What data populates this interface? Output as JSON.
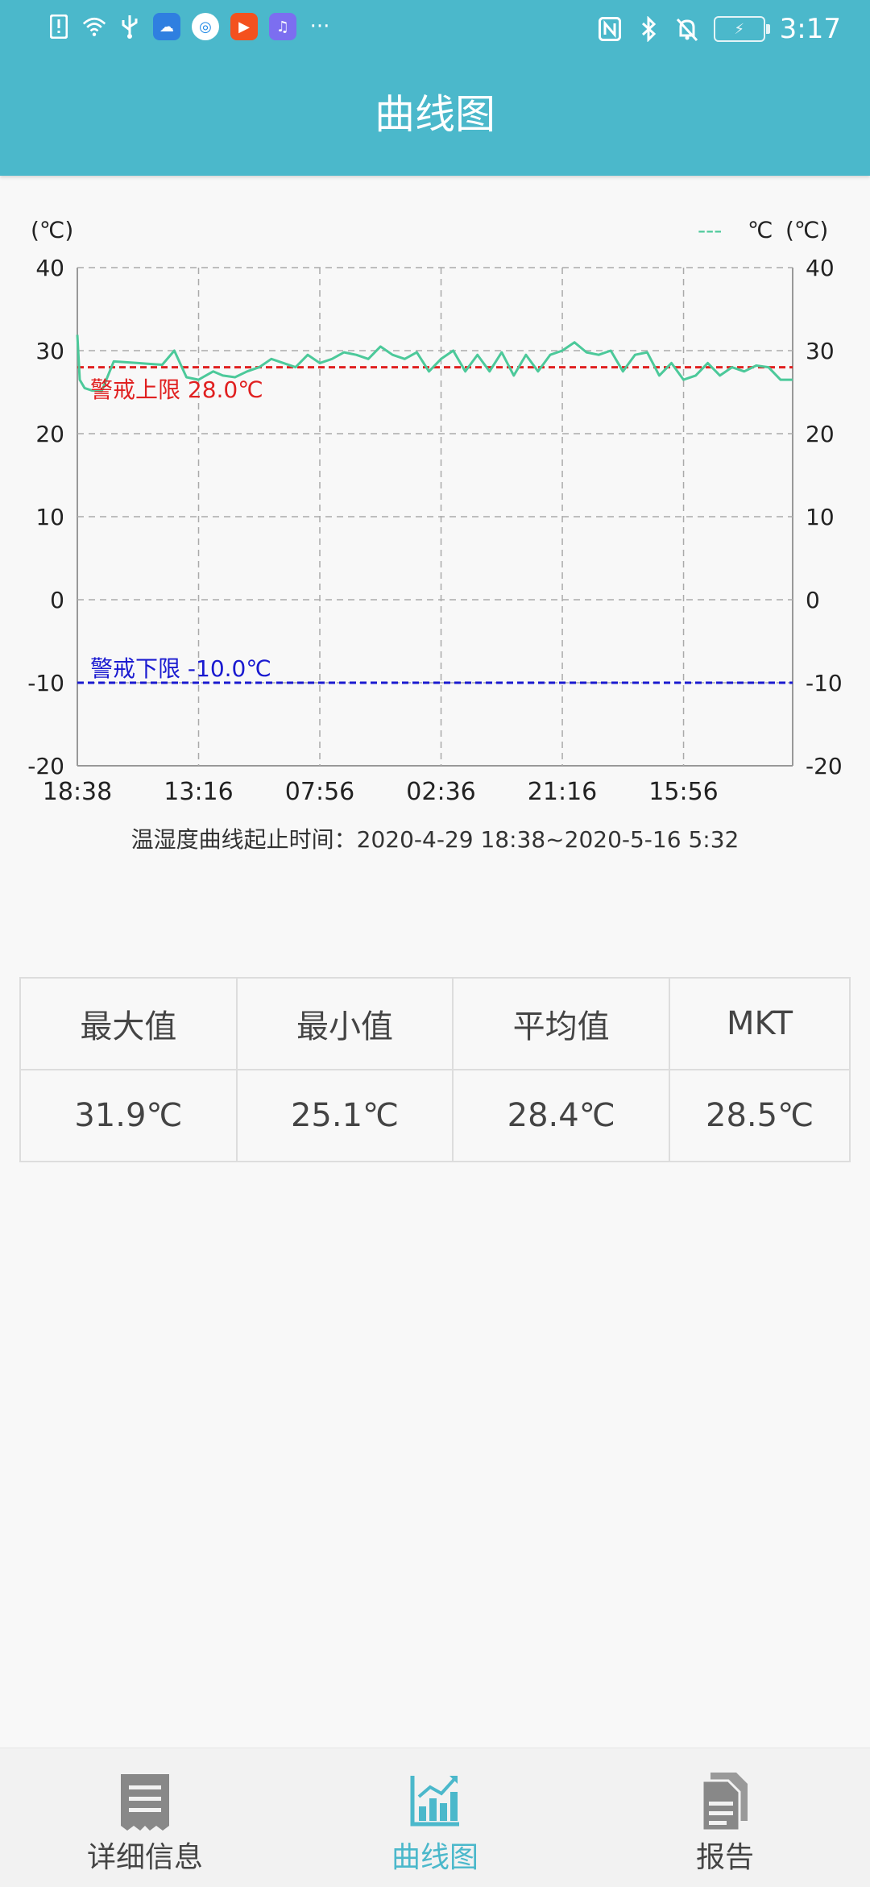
{
  "status_bar": {
    "time": "3:17",
    "left_icons": [
      "alert-icon",
      "wifi-icon",
      "usb-icon",
      "cloud-app-icon",
      "browser-app-icon",
      "video-app-icon",
      "music-app-icon",
      "more-dots-icon"
    ],
    "right_icons": [
      "nfc-icon",
      "bluetooth-icon",
      "mute-icon",
      "battery-charging-icon"
    ],
    "more": "···"
  },
  "header": {
    "title": "曲线图"
  },
  "chart": {
    "left_unit": "(℃)",
    "right_unit": "(℃)",
    "legend": {
      "marker": "---",
      "label": "℃"
    },
    "upper_limit_label": "警戒上限 28.0℃",
    "lower_limit_label": "警戒下限 -10.0℃",
    "upper_color": "#e02020",
    "lower_color": "#1a1ad0",
    "line_color": "#4cc99a"
  },
  "chart_data": {
    "type": "line",
    "ylim": [
      -20,
      40
    ],
    "y_ticks": [
      "40",
      "30",
      "20",
      "10",
      "0",
      "-10",
      "-20"
    ],
    "x_ticks": [
      "18:38",
      "13:16",
      "07:56",
      "02:36",
      "21:16",
      "15:56"
    ],
    "thresholds": [
      {
        "name": "警戒上限",
        "value": 28.0
      },
      {
        "name": "警戒下限",
        "value": -10.0
      }
    ],
    "series": [
      {
        "name": "℃",
        "x": [
          0,
          0.1,
          0.3,
          0.6,
          1.0,
          1.5,
          2.0,
          2.5,
          3.0,
          3.5,
          4.0,
          4.5,
          5.0,
          5.3,
          5.6,
          6.0,
          6.5,
          7.0,
          7.5,
          8.0,
          8.5,
          9.0,
          9.5,
          10.0,
          10.5,
          11.0,
          11.5,
          12.0,
          12.5,
          13.0,
          13.5,
          14.0,
          14.5,
          15.0,
          15.5,
          16.0,
          16.5,
          17.0,
          17.5,
          18.0,
          18.5,
          19.0,
          19.5,
          20.0,
          20.5,
          21.0,
          21.5,
          22.0,
          22.5,
          23.0,
          23.5,
          24.0,
          24.5,
          25.0,
          25.5,
          26.0,
          26.5,
          27.0,
          27.5,
          28.0,
          28.5,
          29.0,
          29.5
        ],
        "values": [
          31.9,
          26.5,
          25.5,
          25.2,
          25.1,
          28.7,
          28.6,
          28.5,
          28.4,
          28.3,
          30.0,
          26.8,
          26.5,
          27.0,
          27.5,
          27.0,
          26.8,
          27.5,
          28.0,
          29.0,
          28.5,
          28.0,
          29.5,
          28.5,
          29.0,
          29.8,
          29.5,
          29.0,
          30.5,
          29.5,
          29.0,
          29.8,
          27.5,
          29.0,
          30.0,
          27.5,
          29.5,
          27.5,
          29.8,
          27.0,
          29.5,
          27.5,
          29.5,
          30.0,
          31.0,
          29.8,
          29.5,
          30.0,
          27.5,
          29.5,
          29.8,
          27.0,
          28.5,
          26.5,
          27.0,
          28.5,
          27.0,
          28.0,
          27.5,
          28.2,
          28.0,
          26.5,
          26.5
        ]
      }
    ]
  },
  "time_range_caption": "温湿度曲线起止时间：2020-4-29  18:38~2020-5-16  5:32",
  "stats": {
    "headers": [
      "最大值",
      "最小值",
      "平均值",
      "MKT"
    ],
    "values": [
      "31.9℃",
      "25.1℃",
      "28.4℃",
      "28.5℃"
    ]
  },
  "bottom_nav": [
    {
      "label": "详细信息",
      "icon": "receipt-icon",
      "active": false
    },
    {
      "label": "曲线图",
      "icon": "bar-chart-icon",
      "active": true
    },
    {
      "label": "报告",
      "icon": "document-icon",
      "active": false
    }
  ]
}
